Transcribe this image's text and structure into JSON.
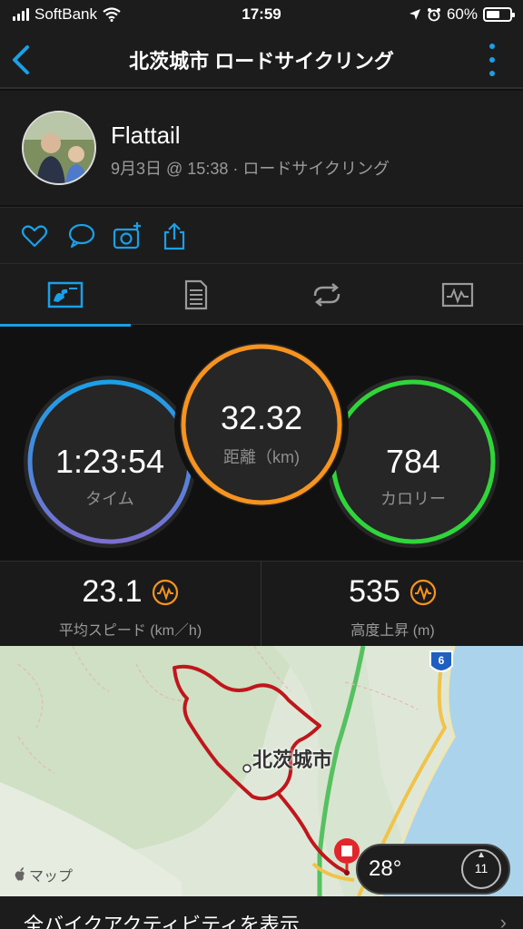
{
  "status_bar": {
    "carrier": "SoftBank",
    "time": "17:59",
    "battery": "60%",
    "battery_level": 0.6
  },
  "header": {
    "title": "北茨城市 ロードサイクリング",
    "back_icon": "chevron-left-icon",
    "menu_icon": "more-vertical-icon"
  },
  "profile": {
    "name": "Flattail",
    "meta": "9月3日 @ 15:38 · ロードサイクリング"
  },
  "actions": [
    "like-icon",
    "comment-icon",
    "add-photo-icon",
    "share-icon"
  ],
  "tabs": [
    {
      "name": "overview",
      "icon": "overview-icon",
      "selected": true
    },
    {
      "name": "details",
      "icon": "details-icon",
      "selected": false
    },
    {
      "name": "laps",
      "icon": "laps-icon",
      "selected": false
    },
    {
      "name": "charts",
      "icon": "charts-icon",
      "selected": false
    }
  ],
  "summary": {
    "time": {
      "value": "1:23:54",
      "label": "タイム",
      "color": "#7b6fcf"
    },
    "distance": {
      "value": "32.32",
      "label": "距離（km)",
      "color": "#f7931e"
    },
    "calories": {
      "value": "784",
      "label": "カロリー",
      "color": "#2fd63a"
    }
  },
  "stats": {
    "avg_speed": {
      "value": "23.1",
      "label": "平均スピード (km／h)"
    },
    "elevation_gain": {
      "value": "535",
      "label": "高度上昇 (m)"
    }
  },
  "map": {
    "city_label": "北茨城市",
    "route_shield": "6",
    "credit": "マップ",
    "weather_temp": "28°",
    "wind": "11"
  },
  "footer": {
    "label": "全バイクアクティビティを表示"
  },
  "colors": {
    "accent": "#1aa0e8",
    "route": "#c0161c",
    "stat_icon": "#f7931e"
  }
}
